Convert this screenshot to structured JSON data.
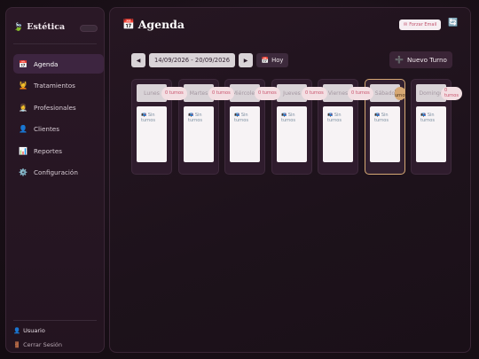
{
  "app": {
    "name": "Estética",
    "logo_icon": "leaf-icon"
  },
  "sidebar": {
    "items": [
      {
        "label": "Agenda",
        "icon": "calendar-icon",
        "glyph": "📅",
        "active": true
      },
      {
        "label": "Tratamientos",
        "icon": "spa-icon",
        "glyph": "💆",
        "active": false
      },
      {
        "label": "Profesionales",
        "icon": "professional-icon",
        "glyph": "👩‍⚕️",
        "active": false
      },
      {
        "label": "Clientes",
        "icon": "user-icon",
        "glyph": "👤",
        "active": false
      },
      {
        "label": "Reportes",
        "icon": "chart-icon",
        "glyph": "📊",
        "active": false
      },
      {
        "label": "Configuración",
        "icon": "gear-icon",
        "glyph": "⚙️",
        "active": false
      }
    ],
    "user_label": "Usuario",
    "logout_label": "Cerrar Sesión"
  },
  "header": {
    "title": "Agenda",
    "email_button": "Forzar Email",
    "refresh_icon": "refresh-icon"
  },
  "toolbar": {
    "prev_label": "◀",
    "next_label": "▶",
    "date_range": "14/09/2026 - 20/09/2026",
    "today_label": "Hoy",
    "new_label": "Nuevo Turno"
  },
  "week": {
    "empty_text": "📭 Sin turnos",
    "days": [
      {
        "name": "Lunes",
        "badge": "0 turnos",
        "active": false
      },
      {
        "name": "Martes",
        "badge": "0 turnos",
        "active": false
      },
      {
        "name": "Miércoles",
        "badge": "0 turnos",
        "active": false
      },
      {
        "name": "Jueves",
        "badge": "0 turnos",
        "active": false
      },
      {
        "name": "Viernes",
        "badge": "0 turnos",
        "active": false
      },
      {
        "name": "Sábado",
        "badge": "0 turnos",
        "active": true
      },
      {
        "name": "Domingo",
        "badge": "0 turnos",
        "active": false
      }
    ]
  },
  "colors": {
    "accent": "#d6a874",
    "active_nav": "#3d2540",
    "badge_text": "#c8506a"
  }
}
